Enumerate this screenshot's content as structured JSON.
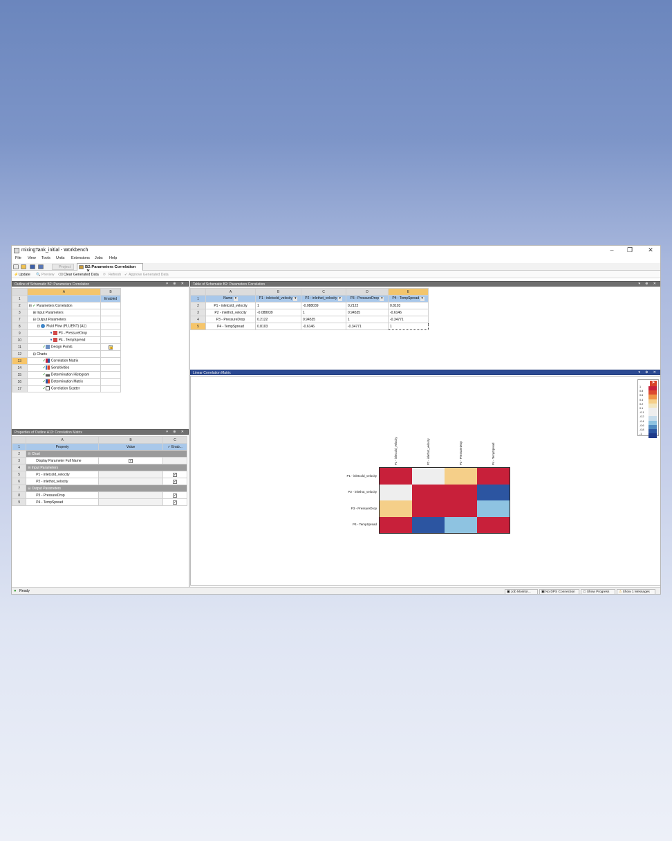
{
  "window": {
    "title": "mixingTank_initial - Workbench",
    "controls": [
      "–",
      "❐",
      "✕"
    ]
  },
  "menu": [
    "File",
    "View",
    "Tools",
    "Units",
    "Extensions",
    "Jobs",
    "Help"
  ],
  "tabs": {
    "project": "Project",
    "active": "B2:Parameters Correlation",
    "close": "✕"
  },
  "toolbar": {
    "update": "Update",
    "preview": "Preview",
    "clear": "Clear Generated Data",
    "refresh": "Refresh",
    "approve": "Approve Generated Data"
  },
  "outline": {
    "header": "Outline of Schematic B2: Parameters Correlation",
    "col_a": "A",
    "col_b": "B",
    "enabled": "Enabled",
    "rows": [
      {
        "n": "1",
        "label": ""
      },
      {
        "n": "2",
        "label": "Parameters Correlation"
      },
      {
        "n": "3",
        "label": "Input Parameters"
      },
      {
        "n": "7",
        "label": "Output Parameters"
      },
      {
        "n": "8",
        "label": "Fluid Flow (FLUENT) (A1)"
      },
      {
        "n": "9",
        "label": "P3 - PressureDrop"
      },
      {
        "n": "10",
        "label": "P4 - TempSpread"
      },
      {
        "n": "11",
        "label": "Design Points"
      },
      {
        "n": "12",
        "label": "Charts"
      },
      {
        "n": "13",
        "label": "Correlation Matrix"
      },
      {
        "n": "14",
        "label": "Sensitivities"
      },
      {
        "n": "15",
        "label": "Determination Histogram"
      },
      {
        "n": "16",
        "label": "Determination Matrix"
      },
      {
        "n": "17",
        "label": "Correlation Scatter"
      }
    ]
  },
  "props": {
    "header": "Properties of Outline A13: Correlation Matrix",
    "col_a": "A",
    "col_b": "B",
    "col_c": "C",
    "h_property": "Property",
    "h_value": "Value",
    "h_enabled": "Enab...",
    "rows": [
      {
        "n": "2",
        "label": "Chart"
      },
      {
        "n": "3",
        "label": "Display Parameter Full Name"
      },
      {
        "n": "4",
        "label": "Input Parameters"
      },
      {
        "n": "5",
        "label": "P1 - inletcold_velocity"
      },
      {
        "n": "6",
        "label": "P2 - inlethot_velocity"
      },
      {
        "n": "7",
        "label": "Output Parameters"
      },
      {
        "n": "8",
        "label": "P3 - PressureDrop"
      },
      {
        "n": "9",
        "label": "P4 - TempSpread"
      }
    ]
  },
  "table": {
    "header": "Table of Schematic B2: Parameters Correlation",
    "cols": [
      "A",
      "B",
      "C",
      "D",
      "E"
    ],
    "headers": [
      "Name",
      "P1 - inletcold_velocity",
      "P2 - inlethot_velocity",
      "P3 - PressureDrop",
      "P4 - TempSpread"
    ],
    "rows": [
      {
        "n": "2",
        "cells": [
          "P1 - inletcold_velocity",
          "1",
          "-0.088039",
          "0.2122",
          "0.8103"
        ]
      },
      {
        "n": "3",
        "cells": [
          "P2 - inlethot_velocity",
          "-0.088039",
          "1",
          "0.94535",
          "-0.6146"
        ]
      },
      {
        "n": "4",
        "cells": [
          "P3 - PressureDrop",
          "0.2122",
          "0.94535",
          "1",
          "-0.34771"
        ]
      },
      {
        "n": "5",
        "cells": [
          "P4 - TempSpread",
          "0.8103",
          "-0.6146",
          "-0.34771",
          "1"
        ]
      }
    ]
  },
  "chart": {
    "header": "Linear Correlation Matrix"
  },
  "chart_data": {
    "type": "heatmap",
    "title": "",
    "x": [
      "P1 - inletcold_velocity",
      "P2 - inlethot_velocity",
      "P3 - PressureDrop",
      "P4 - TempSpread"
    ],
    "y": [
      "P1 - inletcold_velocity",
      "P2 - inlethot_velocity",
      "P3 - PressureDrop",
      "P4 - TempSpread"
    ],
    "values": [
      [
        1,
        -0.088039,
        0.2122,
        0.8103
      ],
      [
        -0.088039,
        1,
        0.94535,
        -0.6146
      ],
      [
        0.2122,
        0.94535,
        1,
        -0.34771
      ],
      [
        0.8103,
        -0.6146,
        -0.34771,
        1
      ]
    ],
    "legend_position": "top-right",
    "legend_ticks": [
      "1",
      "0.8",
      "0.6",
      "0.4",
      "0.2",
      "0.1",
      "-0.1",
      "-0.2",
      "-0.4",
      "-0.6",
      "-0.8",
      "-1"
    ],
    "legend_colors": [
      "#c8203a",
      "#dc4a2f",
      "#ef9546",
      "#f5cf89",
      "#f2e6bf",
      "#eeeeee",
      "#eeeeee",
      "#c6dceb",
      "#8ec3e1",
      "#4f8ac0",
      "#2c55a1",
      "#1f3a8a"
    ]
  },
  "status": {
    "ready": "Ready",
    "job": "Job Monitor...",
    "dps": "No DPS Connection",
    "progress": "Show Progress",
    "messages": "Show 1 Messages"
  }
}
